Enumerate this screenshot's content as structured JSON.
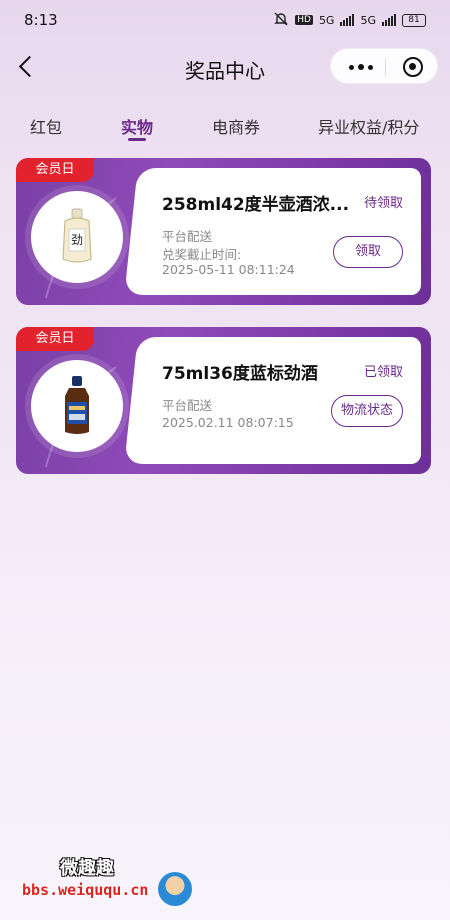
{
  "status_bar": {
    "time": "8:13",
    "network1": "5G",
    "network2": "5G",
    "hd": "HD",
    "battery": "81"
  },
  "nav": {
    "title": "奖品中心"
  },
  "tabs": [
    {
      "label": "红包",
      "active": false
    },
    {
      "label": "实物",
      "active": true
    },
    {
      "label": "电商券",
      "active": false
    },
    {
      "label": "异业权益/积分",
      "active": false
    }
  ],
  "cards": [
    {
      "badge": "会员日",
      "name": "258ml42度半壶酒浓...",
      "status": "待领取",
      "delivery": "平台配送",
      "deadline_label": "兑奖截止时间:",
      "date": "2025-05-11 08:11:24",
      "button": "领取"
    },
    {
      "badge": "会员日",
      "name": "75ml36度蓝标劲酒",
      "status": "已领取",
      "delivery": "平台配送",
      "date": "2025.02.11 08:07:15",
      "button": "物流状态"
    }
  ],
  "watermark": {
    "title": "微趣趣",
    "url": "bbs.weiququ.cn"
  },
  "colors": {
    "accent": "#6a2a8b",
    "badge": "#e2232e",
    "card": "#7d3aa8"
  }
}
